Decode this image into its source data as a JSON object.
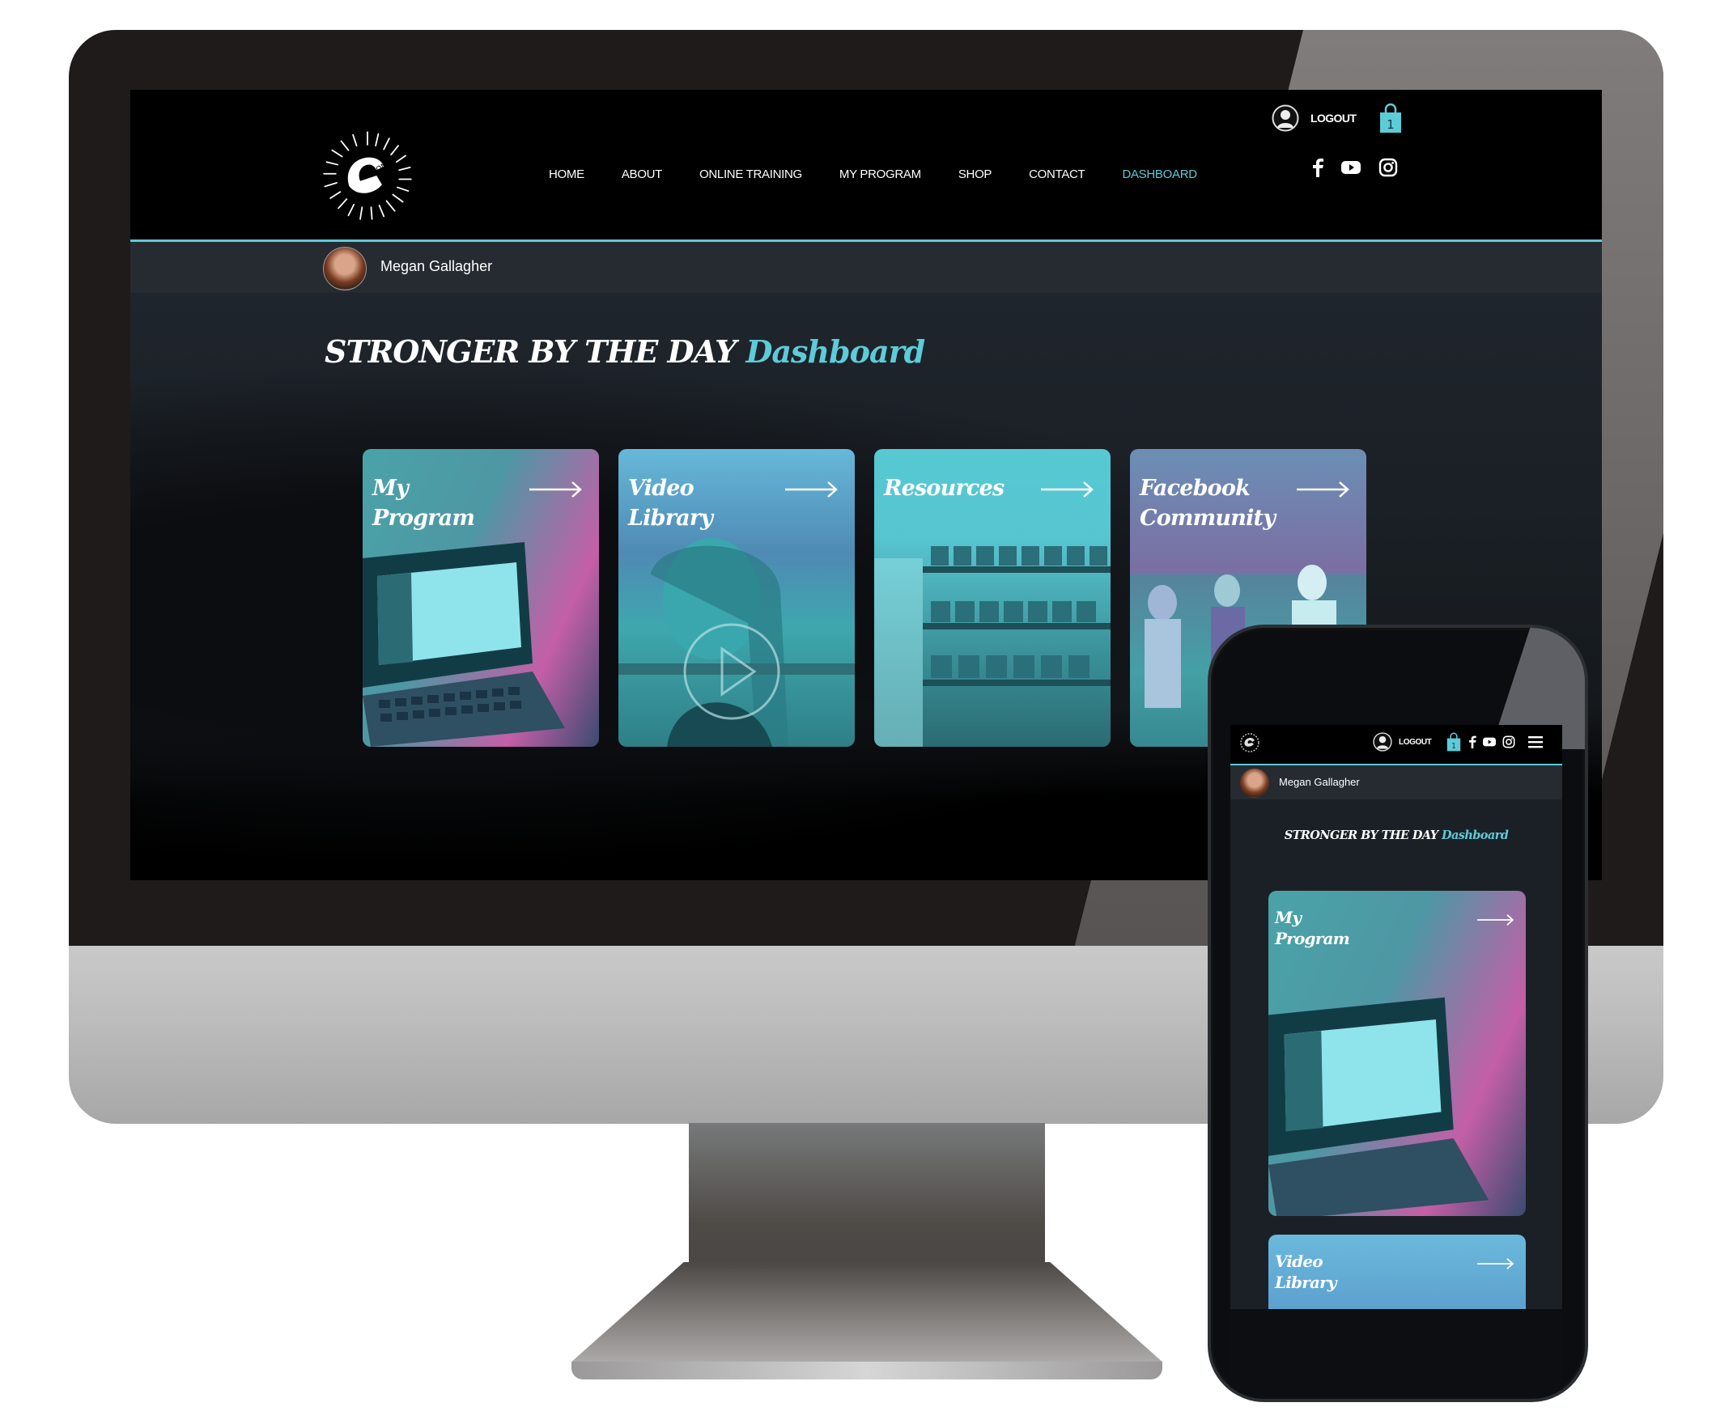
{
  "desktop": {
    "nav": {
      "logo_alt": "Strong Strong Friends logo",
      "links": [
        {
          "label": "HOME",
          "active": false
        },
        {
          "label": "ABOUT",
          "active": false
        },
        {
          "label": "ONLINE TRAINING",
          "active": false
        },
        {
          "label": "MY PROGRAM",
          "active": false
        },
        {
          "label": "SHOP",
          "active": false
        },
        {
          "label": "CONTACT",
          "active": false
        },
        {
          "label": "DASHBOARD",
          "active": true
        }
      ],
      "logout_label": "LOGOUT",
      "cart_count": "1",
      "social": [
        "facebook-icon",
        "youtube-icon",
        "instagram-icon"
      ]
    },
    "user": {
      "name": "Megan Gallagher"
    },
    "headline": {
      "main": "STRONGER BY THE DAY",
      "accent": "Dashboard"
    },
    "cards": [
      {
        "line1": "My",
        "line2": "Program",
        "image": "laptop-screen-image"
      },
      {
        "line1": "Video",
        "line2": "Library",
        "image": "trainer-video-image"
      },
      {
        "line1": "Resources",
        "line2": "",
        "image": "dumbbell-rack-image"
      },
      {
        "line1": "Facebook",
        "line2": "Community",
        "image": "group-photo-image"
      }
    ]
  },
  "mobile": {
    "logout_label": "LOGOUT",
    "cart_count": "1",
    "user": {
      "name": "Megan Gallagher"
    },
    "headline": {
      "main": "STRONGER BY THE DAY",
      "accent": "Dashboard"
    },
    "cards": [
      {
        "line1": "My",
        "line2": "Program"
      },
      {
        "line1": "Video",
        "line2": "Library"
      }
    ]
  },
  "colors": {
    "accent": "#5dcbd8",
    "nav_bg": "#000000",
    "user_bar_bg": "#262b32",
    "page_bg": "#1f252c",
    "pink": "#c45fa7"
  }
}
